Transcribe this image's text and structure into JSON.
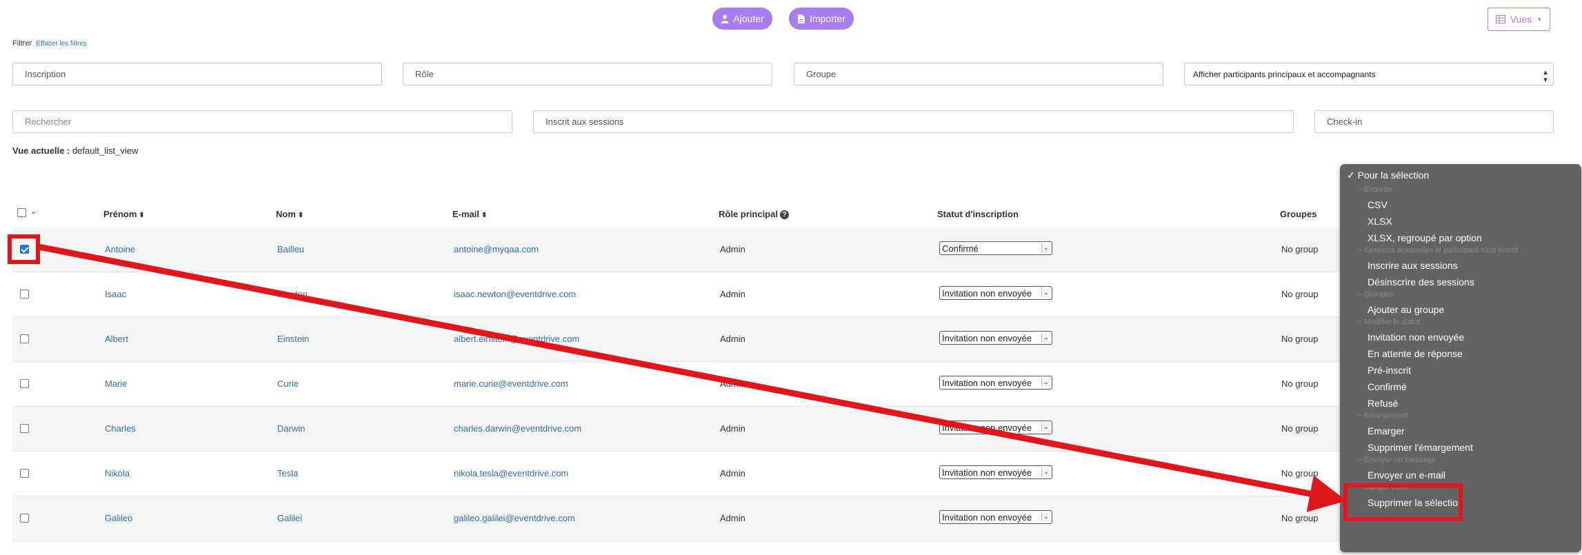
{
  "toolbar": {
    "add_label": "Ajouter",
    "import_label": "Importer",
    "views_label": "Vues",
    "accent_color": "#a77df0"
  },
  "filters": {
    "label": "Filtrer",
    "clear_label": "Effacer les filtres",
    "inscription": "Inscription",
    "role": "Rôle",
    "groupe": "Groupe",
    "participants_select": "Afficher participants principaux et accompagnants",
    "search_placeholder": "Rechercher",
    "sessions": "Inscrit aux sessions",
    "checkin": "Check-in"
  },
  "current_view": {
    "label": "Vue actuelle :",
    "value": "default_list_view"
  },
  "table": {
    "headers": {
      "firstname": "Prénom",
      "lastname": "Nom",
      "email": "E-mail",
      "role": "Rôle principal",
      "status": "Statut d'inscription",
      "groups": "Groupes"
    },
    "rows": [
      {
        "checked": true,
        "firstname": "Antoine",
        "lastname": "Bailleu",
        "email": "antoine@myqaa.com",
        "role": "Admin",
        "status": "Confirmé",
        "groups": "No group"
      },
      {
        "checked": false,
        "firstname": "Isaac",
        "lastname": "Newton",
        "email": "isaac.newton@eventdrive.com",
        "role": "Admin",
        "status": "Invitation non envoyée",
        "groups": "No group"
      },
      {
        "checked": false,
        "firstname": "Albert",
        "lastname": "Einstein",
        "email": "albert.einstein@eventdrive.com",
        "role": "Admin",
        "status": "Invitation non envoyée",
        "groups": "No group"
      },
      {
        "checked": false,
        "firstname": "Marie",
        "lastname": "Curie",
        "email": "marie.curie@eventdrive.com",
        "role": "Admin",
        "status": "Invitation non envoyée",
        "groups": "No group"
      },
      {
        "checked": false,
        "firstname": "Charles",
        "lastname": "Darwin",
        "email": "charles.darwin@eventdrive.com",
        "role": "Admin",
        "status": "Invitation non envoyée",
        "groups": "No group"
      },
      {
        "checked": false,
        "firstname": "Nikola",
        "lastname": "Tesla",
        "email": "nikola.tesla@eventdrive.com",
        "role": "Admin",
        "status": "Invitation non envoyée",
        "groups": "No group"
      },
      {
        "checked": false,
        "firstname": "Galileo",
        "lastname": "Galilei",
        "email": "galileo.galilei@eventdrive.com",
        "role": "Admin",
        "status": "Invitation non envoyée",
        "groups": "No group"
      }
    ]
  },
  "menu": {
    "selected": "Pour la sélection",
    "sections": [
      {
        "header": "-- Exporter",
        "items": [
          "CSV",
          "XLSX",
          "XLSX, regroupé par option"
        ]
      },
      {
        "header": "-- Sessions auxquelles le participant s'est inscrit",
        "items": [
          "Inscrire aux sessions",
          "Désinscrire des sessions"
        ]
      },
      {
        "header": "-- Groupes",
        "items": [
          "Ajouter au groupe"
        ]
      },
      {
        "header": "-- Modifier le statut",
        "items": [
          "Invitation non envoyée",
          "En attente de réponse",
          "Pré-inscrit",
          "Confirmé",
          "Refusé"
        ]
      },
      {
        "header": "-- Emargement",
        "items": [
          "Emarger",
          "Supprimer l'émargement"
        ]
      },
      {
        "header": "-- Envoyer un message",
        "items": [
          "Envoyer un e-mail"
        ]
      },
      {
        "header": "-- Danger zone",
        "items": [
          "Supprimer la sélection"
        ]
      }
    ]
  },
  "annotation_color": "#e0161c"
}
